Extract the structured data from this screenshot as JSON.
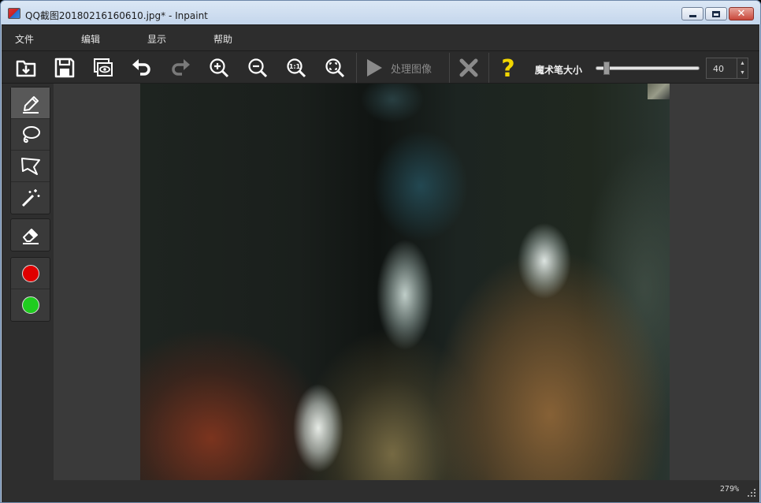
{
  "window": {
    "title": "QQ截图20180216160610.jpg* - Inpaint"
  },
  "menu": {
    "items": [
      {
        "label": "文件"
      },
      {
        "label": "编辑"
      },
      {
        "label": "显示"
      },
      {
        "label": "帮助"
      }
    ]
  },
  "toolbar": {
    "buttons": [
      {
        "name": "open-file-icon"
      },
      {
        "name": "save-icon"
      },
      {
        "name": "preview-icon"
      },
      {
        "name": "undo-icon"
      },
      {
        "name": "redo-icon"
      },
      {
        "name": "zoom-in-icon"
      },
      {
        "name": "zoom-out-icon"
      },
      {
        "name": "actual-size-icon"
      },
      {
        "name": "fit-to-window-icon"
      }
    ],
    "process_label": "处理图像",
    "brush_size_label": "魔术笔大小",
    "brush_size_value": "40",
    "brush_size_fraction": 0.05
  },
  "tools": {
    "selection": [
      {
        "name": "marker-tool-icon",
        "active": true
      },
      {
        "name": "lasso-tool-icon",
        "active": false
      },
      {
        "name": "polygon-lasso-tool-icon",
        "active": false
      },
      {
        "name": "magic-wand-tool-icon",
        "active": false
      }
    ],
    "eraser": {
      "name": "eraser-tool-icon"
    },
    "colors": {
      "remove_color": "#e00000",
      "keep_color": "#1fcc1f"
    }
  },
  "status": {
    "zoom": "279%"
  },
  "colors": {
    "toolbar_bg": "#2b2b2b",
    "help_yellow": "#f2d600"
  }
}
